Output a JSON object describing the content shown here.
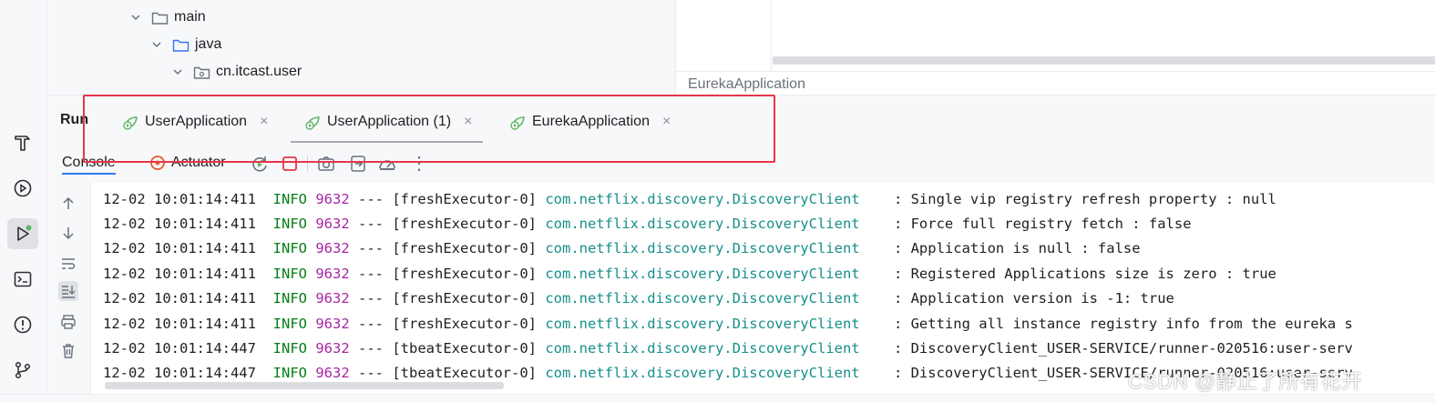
{
  "project_tree": {
    "items": [
      {
        "label": "main",
        "type": "folder"
      },
      {
        "label": "java",
        "type": "source-folder"
      },
      {
        "label": "cn.itcast.user",
        "type": "package"
      }
    ]
  },
  "breadcrumb": {
    "label": "EurekaApplication"
  },
  "run_panel": {
    "title": "Run",
    "tabs": [
      {
        "label": "UserApplication"
      },
      {
        "label": "UserApplication (1)"
      },
      {
        "label": "EurekaApplication"
      }
    ],
    "close_glyph": "×"
  },
  "console_toolbar": {
    "console_tab": "Console",
    "actuator_tab": "Actuator",
    "more_glyph": "⋮"
  },
  "log_lines": [
    {
      "time": "12-02 10:01:14:411",
      "level": "INFO",
      "pid": "9632",
      "sep": "---",
      "thread": "[freshExecutor-0]",
      "logger": "com.netflix.discovery.DiscoveryClient",
      "message": ": Single vip registry refresh property : null"
    },
    {
      "time": "12-02 10:01:14:411",
      "level": "INFO",
      "pid": "9632",
      "sep": "---",
      "thread": "[freshExecutor-0]",
      "logger": "com.netflix.discovery.DiscoveryClient",
      "message": ": Force full registry fetch : false"
    },
    {
      "time": "12-02 10:01:14:411",
      "level": "INFO",
      "pid": "9632",
      "sep": "---",
      "thread": "[freshExecutor-0]",
      "logger": "com.netflix.discovery.DiscoveryClient",
      "message": ": Application is null : false"
    },
    {
      "time": "12-02 10:01:14:411",
      "level": "INFO",
      "pid": "9632",
      "sep": "---",
      "thread": "[freshExecutor-0]",
      "logger": "com.netflix.discovery.DiscoveryClient",
      "message": ": Registered Applications size is zero : true"
    },
    {
      "time": "12-02 10:01:14:411",
      "level": "INFO",
      "pid": "9632",
      "sep": "---",
      "thread": "[freshExecutor-0]",
      "logger": "com.netflix.discovery.DiscoveryClient",
      "message": ": Application version is -1: true"
    },
    {
      "time": "12-02 10:01:14:411",
      "level": "INFO",
      "pid": "9632",
      "sep": "---",
      "thread": "[freshExecutor-0]",
      "logger": "com.netflix.discovery.DiscoveryClient",
      "message": ": Getting all instance registry info from the eureka s"
    },
    {
      "time": "12-02 10:01:14:447",
      "level": "INFO",
      "pid": "9632",
      "sep": "---",
      "thread": "[tbeatExecutor-0]",
      "logger": "com.netflix.discovery.DiscoveryClient",
      "message": ": DiscoveryClient_USER-SERVICE/runner-020516:user-serv"
    },
    {
      "time": "12-02 10:01:14:447",
      "level": "INFO",
      "pid": "9632",
      "sep": "---",
      "thread": "[tbeatExecutor-0]",
      "logger": "com.netflix.discovery.DiscoveryClient",
      "message": ": DiscoveryClient_USER-SERVICE/runner-020516:user-serv"
    }
  ],
  "watermark": "CSDN @静止了所有花开",
  "colors": {
    "highlight": "#e5364b",
    "info": "#067d17",
    "pid": "#a626a4",
    "logger": "#178f8a",
    "run_green": "#5fb865",
    "stop_red": "#e5364b"
  }
}
